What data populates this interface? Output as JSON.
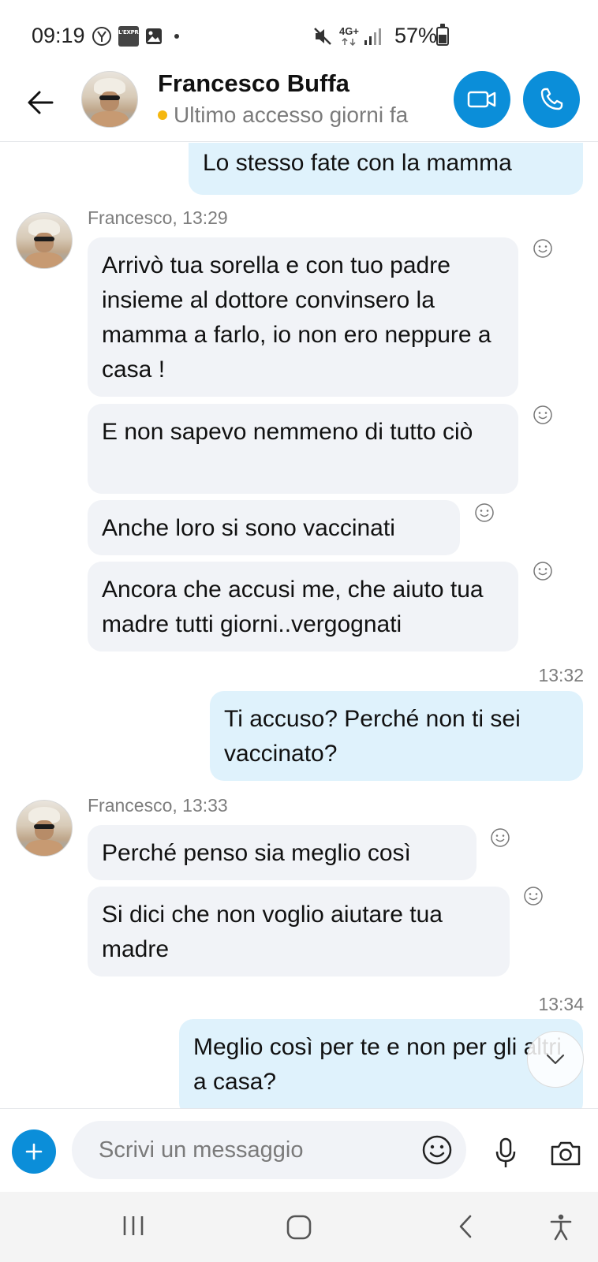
{
  "status_bar": {
    "time": "09:19",
    "network": "4G+",
    "battery": "57%",
    "icons": [
      "yandex-icon",
      "lexpress-news-icon",
      "gallery-icon",
      "notification-dot-icon",
      "mute-icon",
      "signal-icon",
      "battery-icon"
    ],
    "app_badge_text": "L'EXPRESS"
  },
  "header": {
    "contact_name": "Francesco Buffa",
    "presence": "Ultimo accesso giorni fa",
    "presence_color": "#f5b70f",
    "accent_color": "#0b8ed9"
  },
  "messages": [
    {
      "id": "m1",
      "direction": "out",
      "text": "Lo stesso fate con la mamma"
    },
    {
      "id": "g1",
      "sender_line": "Francesco, 13:29"
    },
    {
      "id": "m2",
      "direction": "in",
      "text": "Arrivò tua sorella e con tuo padre insieme al dottore convinsero la mamma a farlo, io non ero neppure a casa !"
    },
    {
      "id": "m3",
      "direction": "in",
      "text": "E non sapevo nemmeno di tutto ciò"
    },
    {
      "id": "m4",
      "direction": "in",
      "text": "Anche loro si sono vaccinati"
    },
    {
      "id": "m5",
      "direction": "in",
      "text": "Ancora che accusi me, che aiuto tua madre tutti giorni..vergognati"
    },
    {
      "id": "t1",
      "time": "13:32"
    },
    {
      "id": "m6",
      "direction": "out",
      "text": "Ti accuso? Perché non ti sei vaccinato?"
    },
    {
      "id": "g2",
      "sender_line": "Francesco, 13:33"
    },
    {
      "id": "m7",
      "direction": "in",
      "text": "Perché penso sia meglio così"
    },
    {
      "id": "m8",
      "direction": "in",
      "text": "Si dici che non voglio aiutare tua madre"
    },
    {
      "id": "t2",
      "time": "13:34"
    },
    {
      "id": "m9",
      "direction": "out",
      "text": "Meglio così per te e non per gli altri a casa?"
    }
  ],
  "composer": {
    "placeholder": "Scrivi un messaggio"
  },
  "nav": {
    "icons": [
      "recent-apps-icon",
      "home-icon",
      "back-nav-icon",
      "accessibility-icon"
    ]
  }
}
